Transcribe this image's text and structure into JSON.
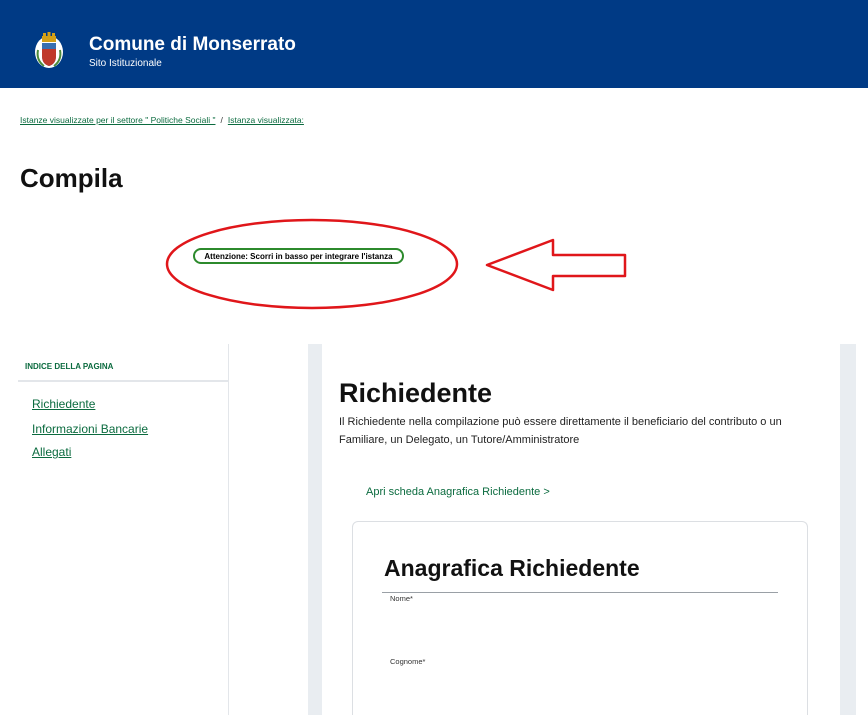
{
  "header": {
    "site_title": "Comune di Monserrato",
    "site_subtitle": "Sito Istituzionale",
    "background_color": "#003a85",
    "logo_icon": "coat-of-arms-icon"
  },
  "breadcrumb": {
    "items": [
      "Istanze visualizzate per il settore \" Politiche Sociali \"",
      "Istanza visualizzata:"
    ],
    "separator": "/"
  },
  "page_title": "Compila",
  "alert": {
    "text": "Attenzione: Scorri in basso per integrare l'istanza",
    "border_color": "#2c8a2c"
  },
  "annotation": {
    "color": "#e0161a",
    "shapes": [
      "ellipse",
      "left-arrow"
    ]
  },
  "toc": {
    "title": "INDICE DELLA PAGINA",
    "items": [
      "Richiedente",
      "Informazioni Bancarie",
      "Allegati"
    ]
  },
  "section": {
    "title": "Richiedente",
    "description": "Il Richiedente nella compilazione può essere direttamente il beneficiario del contributo o un Familiare, un Delegato, un Tutore/Amministratore",
    "open_link": "Apri scheda Anagrafica Richiedente >"
  },
  "anagrafica": {
    "title": "Anagrafica Richiedente",
    "fields": [
      {
        "label": "Nome*",
        "value": ""
      },
      {
        "label": "Cognome*",
        "value": ""
      }
    ]
  },
  "colors": {
    "link_green": "#0b6b3f"
  }
}
